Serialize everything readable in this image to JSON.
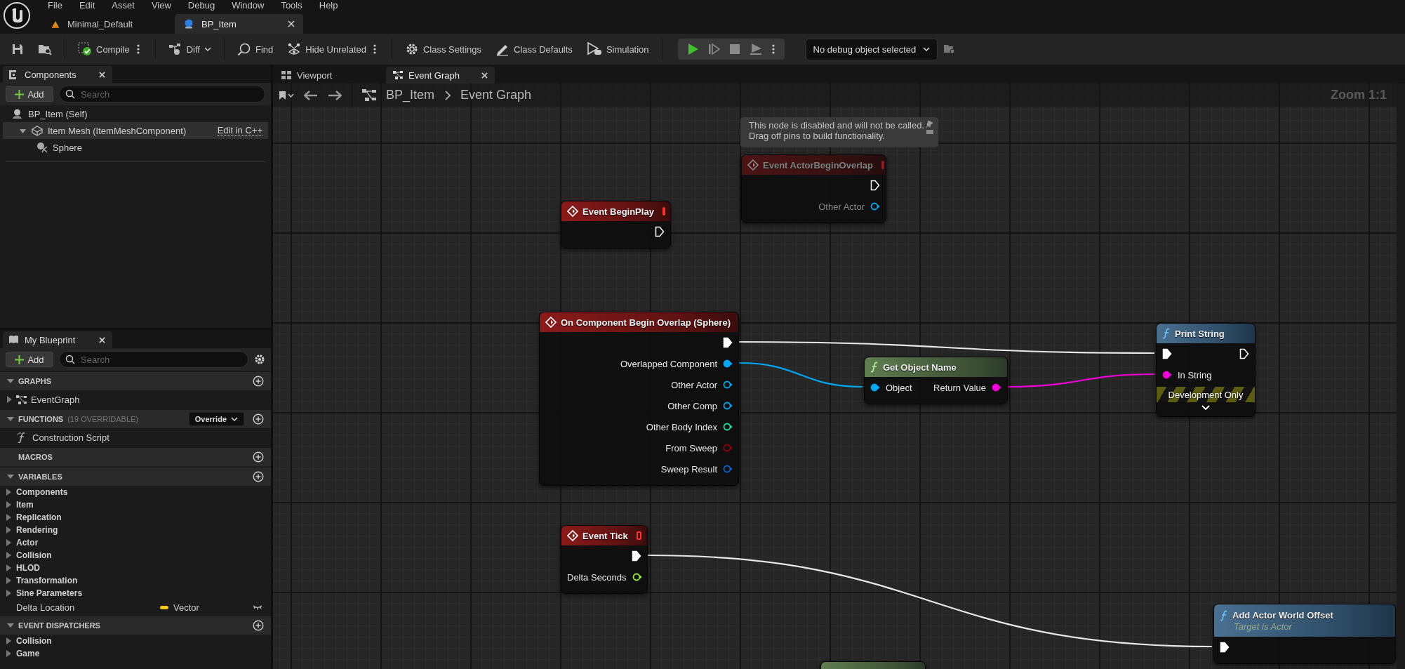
{
  "menu": [
    "File",
    "Edit",
    "Asset",
    "View",
    "Debug",
    "Window",
    "Tools",
    "Help"
  ],
  "document_tabs": [
    {
      "label": "Minimal_Default",
      "kind": "level",
      "selected": false,
      "closable": false
    },
    {
      "label": "BP_Item",
      "kind": "blueprint",
      "selected": true,
      "closable": true
    }
  ],
  "toolbar": [
    {
      "kind": "save"
    },
    {
      "kind": "browse"
    },
    {
      "kind": "compile",
      "label": "Compile",
      "more": true
    },
    {
      "kind": "diff",
      "label": "Diff",
      "dropdown": true
    },
    {
      "kind": "find",
      "label": "Find"
    },
    {
      "kind": "hide",
      "label": "Hide Unrelated",
      "more": true
    },
    {
      "kind": "class-settings",
      "label": "Class Settings"
    },
    {
      "kind": "class-defaults",
      "label": "Class Defaults"
    },
    {
      "kind": "simulation",
      "label": "Simulation"
    }
  ],
  "play_controls": [
    {
      "kind": "play",
      "disabled": false
    },
    {
      "kind": "step",
      "disabled": true
    },
    {
      "kind": "stop",
      "disabled": true
    },
    {
      "kind": "eject",
      "disabled": true
    }
  ],
  "debug_object": "No debug object selected",
  "components_panel": {
    "title": "Components",
    "add": "Add",
    "search": {
      "placeholder": "Search"
    },
    "tree": [
      {
        "label": "BP_Item (Self)",
        "kind": "actor",
        "selected": false,
        "children": [
          {
            "label": "Item Mesh (ItemMeshComponent)",
            "kind": "mesh",
            "selected": true,
            "expanded": true,
            "link": "Edit in C++",
            "children": [
              {
                "label": "Sphere",
                "kind": "sphere",
                "selected": false
              }
            ]
          }
        ]
      }
    ]
  },
  "my_blueprint": {
    "title": "My Blueprint",
    "add": "Add",
    "search": {
      "placeholder": "Search"
    },
    "sections": [
      {
        "title": "GRAPHS",
        "expanded": true,
        "items": [
          {
            "label": "EventGraph",
            "kind": "graph",
            "expanded": false
          }
        ]
      },
      {
        "title": "FUNCTIONS",
        "note": "(19 OVERRIDABLE)",
        "override": "Override",
        "expanded": true,
        "items": [
          {
            "label": "Construction Script",
            "kind": "function"
          }
        ]
      },
      {
        "title": "MACROS"
      },
      {
        "title": "VARIABLES",
        "expanded": true,
        "items": [
          {
            "label": "Components",
            "kind": "category",
            "expanded": false
          },
          {
            "label": "Item",
            "kind": "category",
            "expanded": false
          },
          {
            "label": "Replication",
            "kind": "category",
            "expanded": false
          },
          {
            "label": "Rendering",
            "kind": "category",
            "expanded": false
          },
          {
            "label": "Actor",
            "kind": "category",
            "expanded": false
          },
          {
            "label": "Collision",
            "kind": "category",
            "expanded": false
          },
          {
            "label": "HLOD",
            "kind": "category",
            "expanded": false
          },
          {
            "label": "Transformation",
            "kind": "category",
            "expanded": false
          },
          {
            "label": "Sine Parameters",
            "kind": "category",
            "expanded": false
          },
          {
            "label": "Delta Location",
            "kind": "variable",
            "type": "Vector",
            "color": "#f5c518",
            "public": false
          }
        ]
      },
      {
        "title": "EVENT DISPATCHERS",
        "expanded": true,
        "items": [
          {
            "label": "Collision",
            "kind": "category",
            "expanded": false
          },
          {
            "label": "Game",
            "kind": "category",
            "expanded": false
          }
        ]
      }
    ]
  },
  "graph_tabs": [
    {
      "label": "Viewport",
      "kind": "viewport",
      "selected": false,
      "closable": false
    },
    {
      "label": "Event Graph",
      "kind": "graph",
      "selected": true,
      "closable": true
    }
  ],
  "breadcrumb": [
    "BP_Item",
    "Event Graph"
  ],
  "zoom_label": "Zoom 1:1",
  "comment": {
    "text": "This node is disabled and will not be called.\nDrag off pins to build functionality."
  },
  "nodes": [
    {
      "kind": "event",
      "title": "Event ActorBeginOverlap",
      "disabled": true,
      "rows": [
        {
          "right": {
            "kind": "exec",
            "connected": false
          }
        },
        {
          "right": {
            "label": "Other Actor",
            "kind": "data",
            "color": "#00a8f4",
            "connected": false
          }
        }
      ]
    },
    {
      "kind": "event",
      "title": "Event BeginPlay",
      "disabled": false,
      "rows": [
        {
          "right": {
            "kind": "exec",
            "connected": false
          }
        }
      ]
    },
    {
      "kind": "event",
      "title": "On Component Begin Overlap (Sphere)",
      "disabled": false,
      "rows": [
        {
          "right": {
            "kind": "exec",
            "connected": true
          }
        },
        {
          "right": {
            "label": "Overlapped Component",
            "kind": "data",
            "color": "#00a8f4",
            "connected": true
          }
        },
        {
          "right": {
            "label": "Other Actor",
            "kind": "data",
            "color": "#00a8f4",
            "connected": false
          }
        },
        {
          "right": {
            "label": "Other Comp",
            "kind": "data",
            "color": "#00a8f4",
            "connected": false
          }
        },
        {
          "right": {
            "label": "Other Body Index",
            "kind": "data",
            "color": "#1fe0a6",
            "connected": false
          }
        },
        {
          "right": {
            "label": "From Sweep",
            "kind": "data",
            "color": "#950000",
            "connected": false
          }
        },
        {
          "right": {
            "label": "Sweep Result",
            "kind": "data",
            "color": "#0a62d8",
            "connected": false
          }
        }
      ]
    },
    {
      "kind": "pure",
      "title": "Get Object Name",
      "disabled": false,
      "rows": [
        {
          "left": {
            "label": "Object",
            "kind": "data",
            "color": "#00a8f4",
            "connected": true
          },
          "right": {
            "label": "Return Value",
            "kind": "data",
            "color": "#f000d8",
            "connected": true
          }
        }
      ]
    },
    {
      "kind": "function",
      "title": "Print String",
      "disabled": false,
      "banner": "Development Only",
      "advanced": true,
      "rows": [
        {
          "left": {
            "kind": "exec",
            "connected": true
          },
          "right": {
            "kind": "exec",
            "connected": false
          }
        },
        {
          "left": {
            "label": "In String",
            "kind": "data",
            "color": "#f000d8",
            "connected": true
          }
        }
      ]
    },
    {
      "kind": "event",
      "title": "Event Tick",
      "disabled": false,
      "rows": [
        {
          "right": {
            "kind": "exec",
            "connected": true
          }
        },
        {
          "right": {
            "label": "Delta Seconds",
            "kind": "data",
            "color": "#9af03a",
            "connected": false
          }
        }
      ]
    },
    {
      "kind": "function",
      "title": "Add Actor World Offset",
      "subtitle": "Target is Actor",
      "disabled": false,
      "rows": [
        {
          "left": {
            "kind": "exec",
            "connected": true
          }
        }
      ]
    },
    {
      "kind": "pure",
      "disabled": false
    }
  ]
}
